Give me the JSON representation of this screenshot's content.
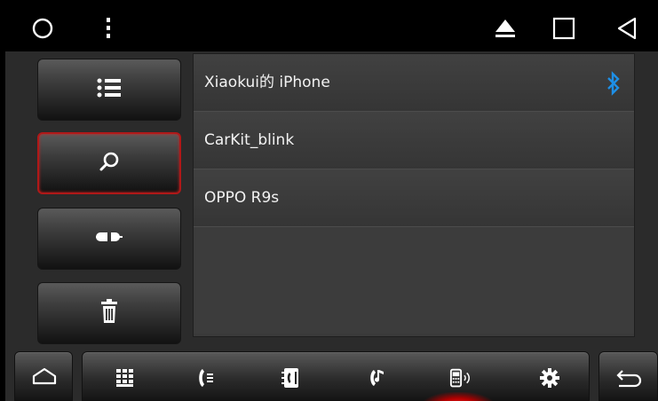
{
  "status_bar": {
    "icons": [
      "circle-icon",
      "more-vertical-icon",
      "eject-icon",
      "square-icon",
      "back-triangle-icon"
    ]
  },
  "side_buttons": [
    {
      "icon": "list-icon",
      "active": false
    },
    {
      "icon": "search-icon",
      "active": true
    },
    {
      "icon": "connect-plug-icon",
      "active": false
    },
    {
      "icon": "trash-icon",
      "active": false
    }
  ],
  "devices": [
    {
      "name": "Xiaokui的 iPhone",
      "connected": true
    },
    {
      "name": "CarKit_blink",
      "connected": false
    },
    {
      "name": "OPPO R9s",
      "connected": false
    }
  ],
  "dock": {
    "icons": [
      "home-icon",
      "dialpad-icon",
      "call-log-icon",
      "contacts-icon",
      "music-phone-icon",
      "phone-bluetooth-icon",
      "settings-icon",
      "return-icon"
    ],
    "active_index": 5
  },
  "colors": {
    "accent": "#1e8fe6",
    "active_border": "#b01818",
    "glow": "#ff2020"
  }
}
